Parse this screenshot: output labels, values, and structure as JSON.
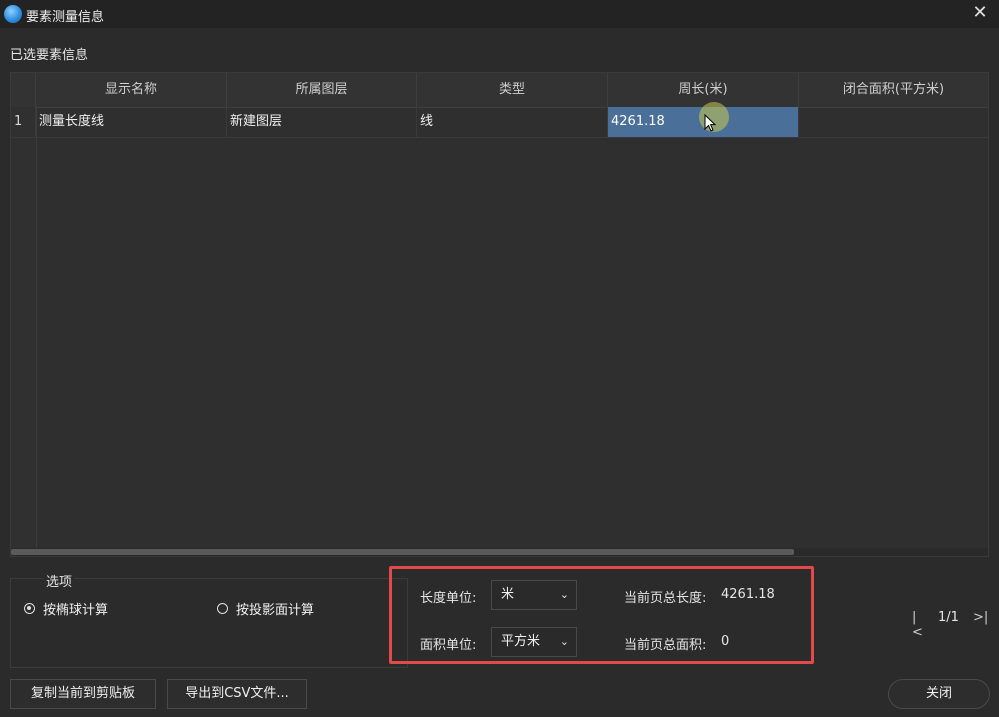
{
  "window": {
    "title": "要素测量信息"
  },
  "section_label": "已选要素信息",
  "table": {
    "columns": [
      "显示名称",
      "所属图层",
      "类型",
      "周长(米)",
      "闭合面积(平方米)"
    ],
    "rows": [
      {
        "index": "1",
        "name": "测量长度线",
        "layer": "新建图层",
        "type": "线",
        "perimeter": "4261.18",
        "area": ""
      }
    ]
  },
  "options": {
    "legend": "选项",
    "radio_ellipsoid": "按椭球计算",
    "radio_projection": "按投影面计算",
    "selected": "ellipsoid"
  },
  "units": {
    "length_label": "长度单位:",
    "length_value": "米",
    "area_label": "面积单位:",
    "area_value": "平方米"
  },
  "totals": {
    "length_label": "当前页总长度:",
    "length_value": "4261.18",
    "area_label": "当前页总面积:",
    "area_value": "0"
  },
  "pager": {
    "text": "1/1"
  },
  "buttons": {
    "copy": "复制当前到剪贴板",
    "export": "导出到CSV文件...",
    "close": "关闭"
  },
  "colors": {
    "highlight": "#e24a4a",
    "selection": "#4a6f99"
  }
}
